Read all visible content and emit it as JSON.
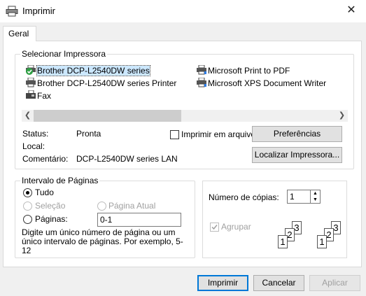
{
  "window": {
    "title": "Imprimir",
    "close_glyph": "✕"
  },
  "tabs": [
    {
      "label": "Geral",
      "selected": true
    }
  ],
  "select_printer": {
    "legend": "Selecionar Impressora",
    "printers": [
      {
        "name": "Brother DCP-L2540DW series",
        "icon": "printer-default-icon",
        "selected": true
      },
      {
        "name": "Microsoft Print to PDF",
        "icon": "printer-network-icon"
      },
      {
        "name": "Brother DCP-L2540DW series Printer",
        "icon": "printer-icon"
      },
      {
        "name": "Microsoft XPS Document Writer",
        "icon": "printer-network-icon"
      },
      {
        "name": "Fax",
        "icon": "fax-icon"
      }
    ],
    "status_label": "Status:",
    "status_value": "Pronta",
    "location_label": "Local:",
    "location_value": "",
    "comment_label": "Comentário:",
    "comment_value": "DCP-L2540DW series LAN",
    "print_to_file_label": "Imprimir em arquivo",
    "print_to_file_checked": false,
    "preferences_button": "Preferências",
    "find_printer_button": "Localizar Impressora..."
  },
  "page_range": {
    "legend": "Intervalo de Páginas",
    "all_label": "Tudo",
    "selection_label": "Seleção",
    "current_page_label": "Página Atual",
    "pages_label": "Páginas:",
    "pages_value": "0-1",
    "help_text": "Digite um único número de página ou um único intervalo de páginas. Por exemplo, 5-12",
    "selected_option": "all"
  },
  "copies": {
    "label": "Número de cópias:",
    "value": "1",
    "collate_label": "Agrupar",
    "collate_checked": true,
    "collate_enabled": false
  },
  "footer": {
    "print_button": "Imprimir",
    "cancel_button": "Cancelar",
    "apply_button": "Aplicar"
  },
  "colors": {
    "accent": "#0078d7",
    "selection_bg": "#cce8ff",
    "check_green": "#2ea043",
    "disabled_text": "#a0a0a0"
  }
}
